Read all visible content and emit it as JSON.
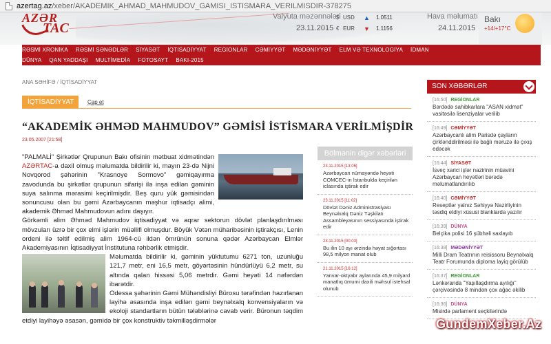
{
  "browser": {
    "url_domain": "azertag.az",
    "url_path": "/xeber/AKADEMIK_AHMAD_MAHMUDOV_GAMISI_ISTISMARA_VERILMISDIR-378275"
  },
  "logo": {
    "top": "AZƏR",
    "bottom": "TAC"
  },
  "currency": {
    "title": "Valyuta məzənnələri",
    "date": "23.11.2015",
    "rates": [
      {
        "symbol": "$",
        "code": "USD",
        "dir": "▲",
        "value": "1.0511"
      },
      {
        "symbol": "€",
        "code": "EUR",
        "dir": "▼",
        "value": "1.1156"
      }
    ]
  },
  "weather": {
    "title": "Hava məlumatı",
    "date": "24.11.2015",
    "city": "Bakı",
    "temp": "+14/+17°C"
  },
  "nav": {
    "row1": [
      "RƏSMİ XRONİKA",
      "RƏSMİ SƏNƏDLƏR",
      "SİYASƏT",
      "İQTİSADİYYAT",
      "REGİONLAR",
      "CƏMİYYƏT",
      "MƏDƏNİYYƏT",
      "ELM VƏ TEXNOLOGİYA",
      "İDMAN"
    ],
    "row2": [
      "DÜNYA",
      "QAN YADDAŞI",
      "MULTİMEDİA",
      "FOTOSAYT",
      "BAKI-2015"
    ]
  },
  "breadcrumb": {
    "home": "ANA SƏHİFƏ",
    "sep": "/",
    "current": "İQTİSADİYYAT"
  },
  "tabs": {
    "active": "İQTİSADİYYAT",
    "print": "Çap et"
  },
  "article": {
    "title": "“AKADEMİK ƏHMƏD MAHMUDOV” GƏMİSİ İSTİSMARA VERİLMİŞDİR",
    "date": "23.05.2007 [21:58]",
    "p1a": "\"PALMALİ\" Şirkətlər Qrupunun Bakı ofisinin mətbuat xidmətindən ",
    "p1_agency": "AZƏRTAC",
    "p1b": "-a daxil olmuş məlumatda bildirilir ki, mayın 23-də Nijni Novqorod şəhərinin \"Krasnoye Sormovo\" gəmiqayırma zavodunda bu şirkətlər qrupunun sifarişi ilə inşa edilən gəminin suya salınma mərasimi keçirilmişdir. Beş quru yük gəmisindən sonuncusu olan bu gəmi Azərbaycanın məşhur iqtisadçı alimi, akademik Əhməd Mahmudovun adını daşıyır.",
    "p2": "Görkəmli alim Əhməd Mahmudov iqtisadiyyat və aqrar sektorun dövlət planlaşdırılması mövzuları üzrə bir çox elmi işlərin müəllifi olmuşdur. Böyük Vətən müharibəsinin iştirakçısı, Lenin ordeni ilə təltif edilmiş alim 1964-cü ildən ömrünün sonuna qədər Azərbaycan Elmlər Akademiyasının İqtisadiyyat İnstitutuna rəhbərlik etmişdir.",
    "p3": "Məlumatda bildirilir ki, gəminin yüktutumu 6271 ton, uzunluğu 121,7 metr, eni 16,5 metr, göyərtəsinin hündürlüyü 6,2 metr, su altında qalan hissəsi 5,06 metrdir. Gəmi heyəti 14 nəfərdən ibarətdir.",
    "p4": "Odessa şəhərinin Gəmi Mühəndisliyi Bürosu tərəfindən hazırlanan layihə əsasında inşa edilən gəmi beynəlxalq konvensiyaların və ekoloji standartların bütün tələblərinə cavab verir. Büronun təqdim etdiyi layihəyə əsasən, gəmidə bir çox konstruktiv təkmilləşdirmələr"
  },
  "other_news": {
    "title": "Bölmənin digər xəbərləri",
    "items": [
      {
        "date": "23.11.2015 [13:05]",
        "text": "Azərbaycan nümayəndə heyəti COMCEC-in İstanbulda keçirilən iclasında iştirak edir"
      },
      {
        "date": "23.11.2015 [11:02]",
        "text": "Dövlət Dəniz Administrasiyası Beynəlxalq Dəniz Təşkilatı Assambleyasının sessiyasında iştirak edir"
      },
      {
        "date": "23.11.2015 [00:03]",
        "text": "Bu ilin 10 ayı ərzində həyat sığortası 98,5 milyon manat olub"
      },
      {
        "date": "21.11.2015 [16:12]",
        "text": "Yanvar-oktyabr aylarında 45,9 milyard manatlıq ümumi daxili məhsul istehsal olunub"
      }
    ]
  },
  "last_news": {
    "title": "SON XƏBƏRLƏR",
    "items": [
      {
        "time": "[16:50]",
        "cat": "REGİONLAR",
        "color": "#3f9b3a",
        "text": "Bərdədə sahibkarlara \"ASAN xidmət\" vasitəsilə lisenziyalar verilib"
      },
      {
        "time": "[16:49]",
        "cat": "CƏMİYYƏT",
        "color": "#c62828",
        "text": "Azərbaycanlı alim Parisdə çayların çirklənddirilməsi ilə bağlı məruzə ilə çıxış edəcək"
      },
      {
        "time": "[16:44]",
        "cat": "SİYASƏT",
        "color": "#c62828",
        "text": "İsveç xarici işlər nazirinin müavini Azərbaycan heyətləri bərədə məlumatlandırılıb"
      },
      {
        "time": "[16:40]",
        "cat": "CƏMİYYƏT",
        "color": "#c62828",
        "text": "Reseptlər yalnız Səhiyyə Nazirliyinin təsdiq etdiyi xüsusi blanklarda yazılır"
      },
      {
        "time": "[16:39]",
        "cat": "DÜNYA",
        "color": "#d24f8a",
        "text": "Belçika polisi 16 şübhəli saxlayıb"
      },
      {
        "time": "[16:38]",
        "cat": "MƏDƏNİYYƏT",
        "color": "#8e3aa6",
        "text": "Milli Dram Teatrının reisissoru Beynəlxalq Teatr Forumunda diploma layiq görülüb"
      },
      {
        "time": "[16:37]",
        "cat": "REGİONLAR",
        "color": "#3f9b3a",
        "text": "Lənkəranda \"Yaşıllaşdırma ayılığı\" çərçivəsində 8 mindən çox ağac əkilib"
      },
      {
        "time": "[16:36]",
        "cat": "DÜNYA",
        "color": "#d24f8a",
        "text": "Misirdə parlament seçkilərində"
      }
    ]
  },
  "watermark": "GundemXeber.Az"
}
